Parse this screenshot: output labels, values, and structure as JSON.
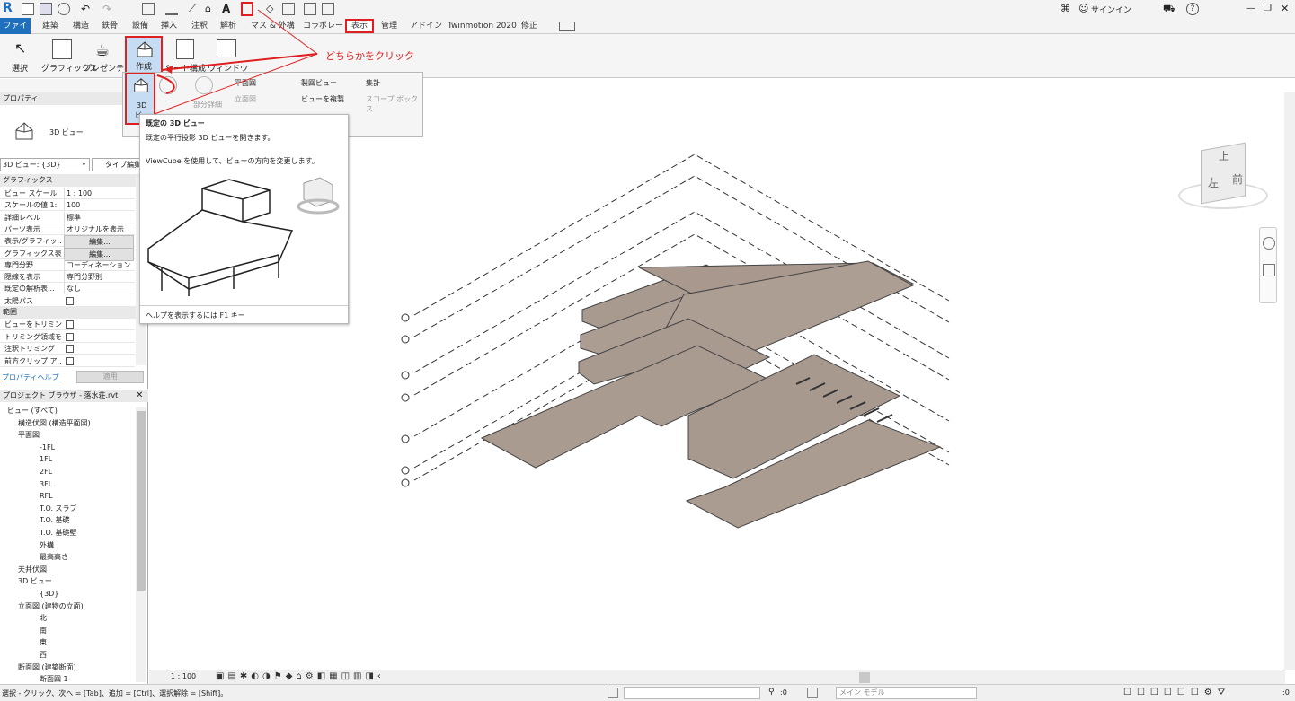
{
  "app": {
    "logo": "R"
  },
  "colors": {
    "accent": "#1f6fbf",
    "annotation": "#e02020",
    "slab": "#a99a90"
  },
  "qat": {
    "user_label": "サインイン"
  },
  "tabs": [
    "ファイル",
    "建築",
    "構造",
    "鉄骨",
    "設備",
    "挿入",
    "注釈",
    "解析",
    "マス & 外構",
    "コラボレート",
    "表示",
    "管理",
    "アドイン",
    "Twinmotion 2020",
    "修正"
  ],
  "active_tab": "表示",
  "ribbon": {
    "buttons": [
      {
        "id": "select",
        "label": "選択"
      },
      {
        "id": "graphics",
        "label": "グラフィックス"
      },
      {
        "id": "presentation",
        "label": "プレゼンテ..."
      },
      {
        "id": "create",
        "label": "作成"
      },
      {
        "id": "sheet",
        "label": "シート構成"
      },
      {
        "id": "window",
        "label": "ウィンドウ"
      }
    ]
  },
  "dropdown": {
    "three_d_label": "3D",
    "three_d_sub": "ビ",
    "detail_label": "部分詳細",
    "plan": "平面図",
    "elevation": "立面図",
    "drafting": "製図ビュー",
    "duplicate": "ビューを複製",
    "schedule": "集計",
    "scope_box": "スコープ ボックス"
  },
  "annotation": {
    "text": "どちらかをクリック"
  },
  "tooltip": {
    "title": "既定の 3D ビュー",
    "line1": "既定の平行投影 3D ビューを開きます。",
    "line2": "ViewCube を使用して、ビューの方向を変更します。",
    "help": "ヘルプを表示するには F1 キー"
  },
  "properties": {
    "header": "プロパティ",
    "type_name": "3D ビュー",
    "selector": "3D ビュー: {3D}",
    "edit_type": "タイプ編集",
    "group_graphics": "グラフィックス",
    "rows": [
      {
        "k": "ビュー スケール",
        "v": "1 : 100"
      },
      {
        "k": "スケールの値 1:",
        "v": "100"
      },
      {
        "k": "詳細レベル",
        "v": "標準"
      },
      {
        "k": "パーツ表示",
        "v": "オリジナルを表示"
      },
      {
        "k": "表示/グラフィッ...",
        "v": "編集..."
      },
      {
        "k": "グラフィックス表...",
        "v": "編集..."
      },
      {
        "k": "専門分野",
        "v": "コーディネーション"
      },
      {
        "k": "隠線を表示",
        "v": "専門分野別"
      },
      {
        "k": "既定の解析表...",
        "v": "なし"
      },
      {
        "k": "太陽パス",
        "v": ""
      }
    ],
    "group_extents": "範囲",
    "rows2": [
      {
        "k": "ビューをトリミング"
      },
      {
        "k": "トリミング領域を..."
      },
      {
        "k": "注釈トリミング"
      },
      {
        "k": "前方クリップ ア..."
      }
    ],
    "help_link": "プロパティヘルプ",
    "apply": "適用"
  },
  "browser": {
    "header": "プロジェクト ブラウザ - 落水荘.rvt",
    "items": [
      {
        "t": "ビュー (すべて)",
        "d": 0
      },
      {
        "t": "構造伏図 (構造平面図)",
        "d": 1
      },
      {
        "t": "平面図",
        "d": 1
      },
      {
        "t": "-1FL",
        "d": 3
      },
      {
        "t": "1FL",
        "d": 3
      },
      {
        "t": "2FL",
        "d": 3
      },
      {
        "t": "3FL",
        "d": 3
      },
      {
        "t": "RFL",
        "d": 3
      },
      {
        "t": "T.O. スラブ",
        "d": 3
      },
      {
        "t": "T.O. 基礎",
        "d": 3
      },
      {
        "t": "T.O. 基礎壁",
        "d": 3
      },
      {
        "t": "外構",
        "d": 3
      },
      {
        "t": "最高高さ",
        "d": 3
      },
      {
        "t": "天井伏図",
        "d": 1
      },
      {
        "t": "3D ビュー",
        "d": 1
      },
      {
        "t": "{3D}",
        "d": 3
      },
      {
        "t": "立面図 (建物の立面)",
        "d": 1
      },
      {
        "t": "北",
        "d": 3
      },
      {
        "t": "南",
        "d": 3
      },
      {
        "t": "東",
        "d": 3
      },
      {
        "t": "西",
        "d": 3
      },
      {
        "t": "断面図 (建築断面)",
        "d": 1
      },
      {
        "t": "断面図 1",
        "d": 3
      }
    ]
  },
  "viewcube": {
    "top": "上",
    "front": "前",
    "left": "左"
  },
  "viewbar": {
    "scale": "1 : 100"
  },
  "status": {
    "hint": "選択 - クリック、次へ = [Tab]、追加 = [Ctrl]、選択解除 = [Shift]。",
    "zero1": ":0",
    "model": "メイン モデル",
    "zero2": ":0"
  }
}
